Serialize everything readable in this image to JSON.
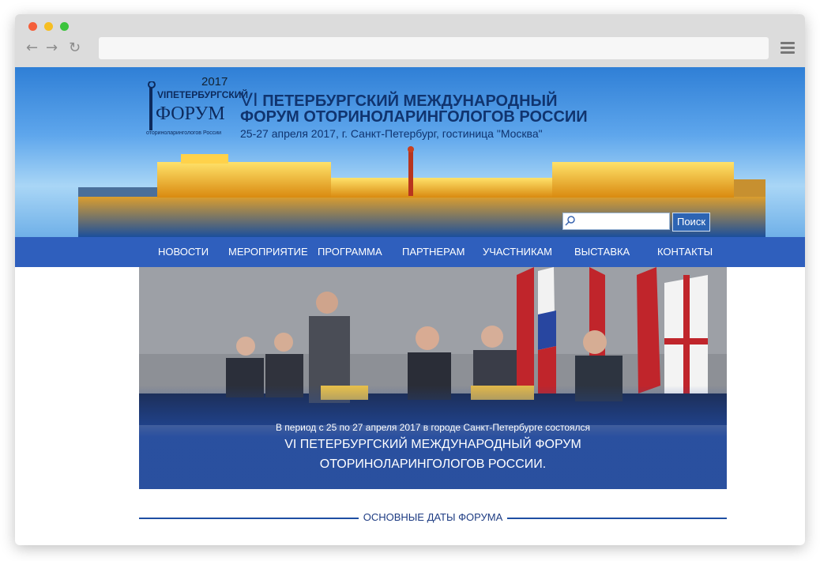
{
  "browser": {
    "back_icon": "←",
    "forward_icon": "→",
    "reload_icon": "↻"
  },
  "header": {
    "logo": {
      "year": "2017",
      "line2": "VIПЕТЕРБУРГСКИЙ",
      "line3": "ФОРУМ",
      "line4": "оториноларингологов России"
    },
    "title_roman": "VI",
    "title_line1": "ПЕТЕРБУРГСКИЙ МЕЖДУНАРОДНЫЙ",
    "title_line2": "ФОРУМ ОТОРИНОЛАРИНГОЛОГОВ РОССИИ",
    "subtitle": "25-27 апреля 2017, г. Санкт-Петербург, гостиница \"Москва\"",
    "search": {
      "value": "",
      "button_label": "Поиск"
    }
  },
  "menu": {
    "items": [
      "НОВОСТИ",
      "МЕРОПРИЯТИЕ",
      "ПРОГРАММА",
      "ПАРТНЕРАМ",
      "УЧАСТНИКАМ",
      "ВЫСТАВКА",
      "КОНТАКТЫ"
    ]
  },
  "hero": {
    "line1": "В период с 25 по 27 апреля 2017 в городе Санкт-Петербурге состоялся",
    "line2": "VI ПЕТЕРБУРГСКИЙ МЕЖДУНАРОДНЫЙ ФОРУМ",
    "line3": "ОТОРИНОЛАРИНГОЛОГОВ РОССИИ."
  },
  "section": {
    "title": "ОСНОВНЫЕ ДАТЫ ФОРУМА"
  },
  "colors": {
    "menu_bg": "#2f5fbd",
    "header_title": "#10346f",
    "hero_overlay": "#214aa0"
  }
}
